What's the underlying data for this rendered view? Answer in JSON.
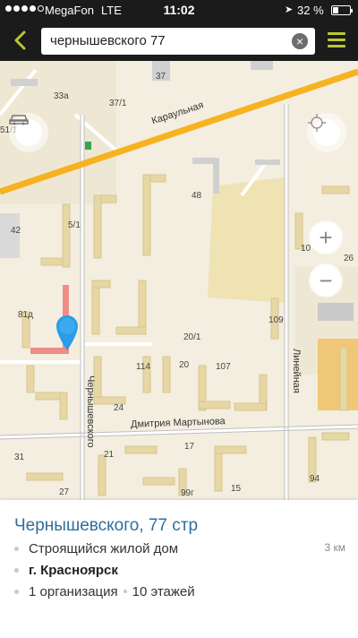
{
  "status_bar": {
    "carrier": "MegaFon",
    "network": "LTE",
    "time": "11:02",
    "battery_percent": "32 %",
    "battery_level": 0.32,
    "signal_bars_filled": 4,
    "signal_bars_total": 5
  },
  "nav_bar": {
    "search_query": "чернышевского 77",
    "accent_color": "#b8c832"
  },
  "map": {
    "labels": {
      "b33a": "33а",
      "b37": "37",
      "b37_1": "37/1",
      "b51_1": "51/1",
      "b48": "48",
      "b42": "42",
      "b5_1": "5/1",
      "b81d": "81д",
      "b109": "109",
      "b20_1": "20/1",
      "b114": "114",
      "b20": "20",
      "b107": "107",
      "b24": "24",
      "b31": "31",
      "b21": "21",
      "b17": "17",
      "b94": "94",
      "b27": "27",
      "b99g": "99г",
      "b15": "15",
      "b10": "10",
      "b26": "26"
    },
    "streets": {
      "karaulnaya": "Караульная",
      "chernyshevskogo": "Чернышевского",
      "dmitriya_martynova": "Дмитрия Мартынова",
      "lineynaya": "Линейная"
    },
    "colors": {
      "background": "#f3eedf",
      "main_road": "#f6b221",
      "building": "#e8d9a8",
      "pin": "#2a9de8"
    }
  },
  "place_card": {
    "title": "Чернышевского, 77 стр",
    "type": "Строящийся жилой дом",
    "distance": "3 км",
    "city": "г. Красноярск",
    "organizations": "1 организация",
    "floors": "10 этажей",
    "title_color": "#2f6e9c"
  }
}
